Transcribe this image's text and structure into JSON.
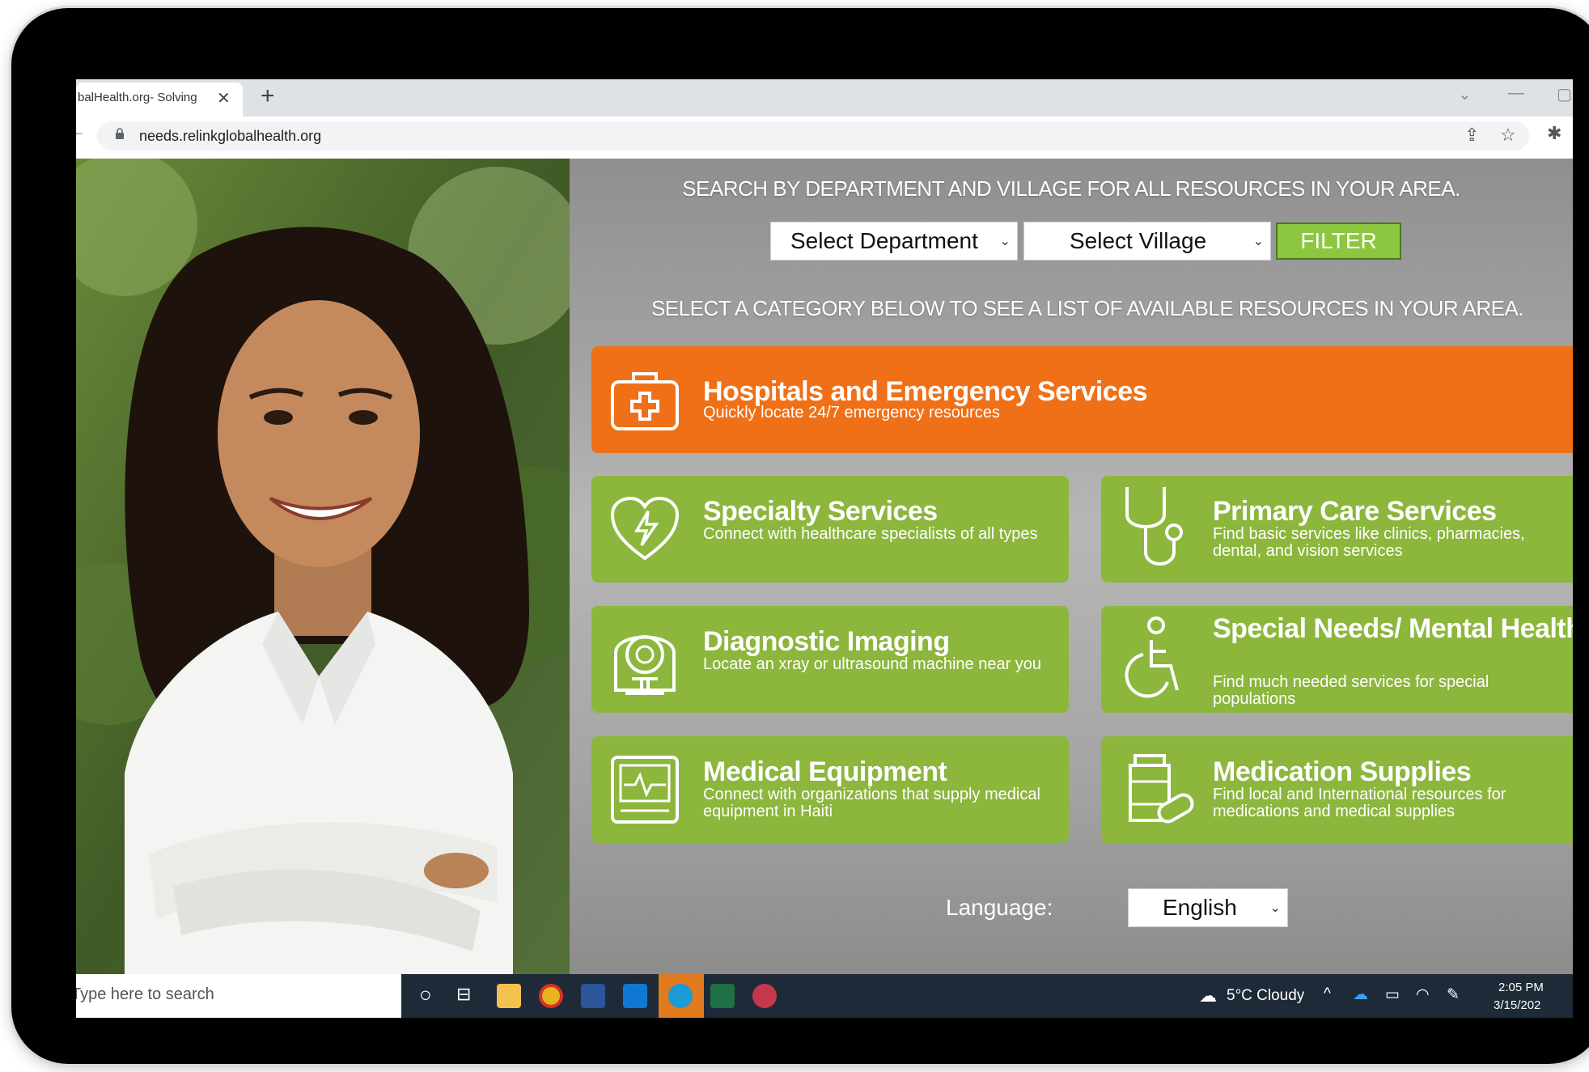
{
  "browser": {
    "tab_title": "balHealth.org- Solving",
    "tab_close": "✕",
    "new_tab": "+",
    "url": "needs.relinkglobalhealth.org"
  },
  "search": {
    "heading": "SEARCH BY DEPARTMENT AND VILLAGE FOR ALL RESOURCES IN YOUR AREA.",
    "department_select": "Select Department",
    "village_select": "Select Village",
    "filter_label": "FILTER"
  },
  "categories": {
    "heading": "SELECT A CATEGORY BELOW TO SEE A LIST OF AVAILABLE RESOURCES IN YOUR AREA.",
    "items": [
      {
        "title": "Hospitals and Emergency Services",
        "desc": "Quickly locate 24/7 emergency resources",
        "icon": "first-aid-kit-icon",
        "color": "#f07017"
      },
      {
        "title": "Specialty Services",
        "desc": "Connect with healthcare specialists of all types",
        "icon": "heart-bolt-icon",
        "color": "#8cb63c"
      },
      {
        "title": "Primary Care Services",
        "desc": "Find basic services like clinics, pharmacies, dental, and vision services",
        "icon": "stethoscope-icon",
        "color": "#8cb63c"
      },
      {
        "title": "Diagnostic Imaging",
        "desc": "Locate an xray or ultrasound machine near you",
        "icon": "scanner-icon",
        "color": "#8cb63c"
      },
      {
        "title": "Special Needs/ Mental Health",
        "desc": "Find much needed services for special populations",
        "icon": "wheelchair-icon",
        "color": "#8cb63c"
      },
      {
        "title": "Medical Equipment",
        "desc": "Connect with organizations that supply medical equipment in Haiti",
        "icon": "monitor-icon",
        "color": "#8cb63c"
      },
      {
        "title": "Medication Supplies",
        "desc": "Find local and International resources for medications and medical supplies",
        "icon": "pill-bottle-icon",
        "color": "#8cb63c"
      }
    ]
  },
  "language": {
    "label": "Language:",
    "value": "English"
  },
  "taskbar": {
    "search_placeholder": "Type here to search",
    "weather": "5°C  Cloudy",
    "time": "2:05 PM",
    "date": "3/15/202"
  }
}
